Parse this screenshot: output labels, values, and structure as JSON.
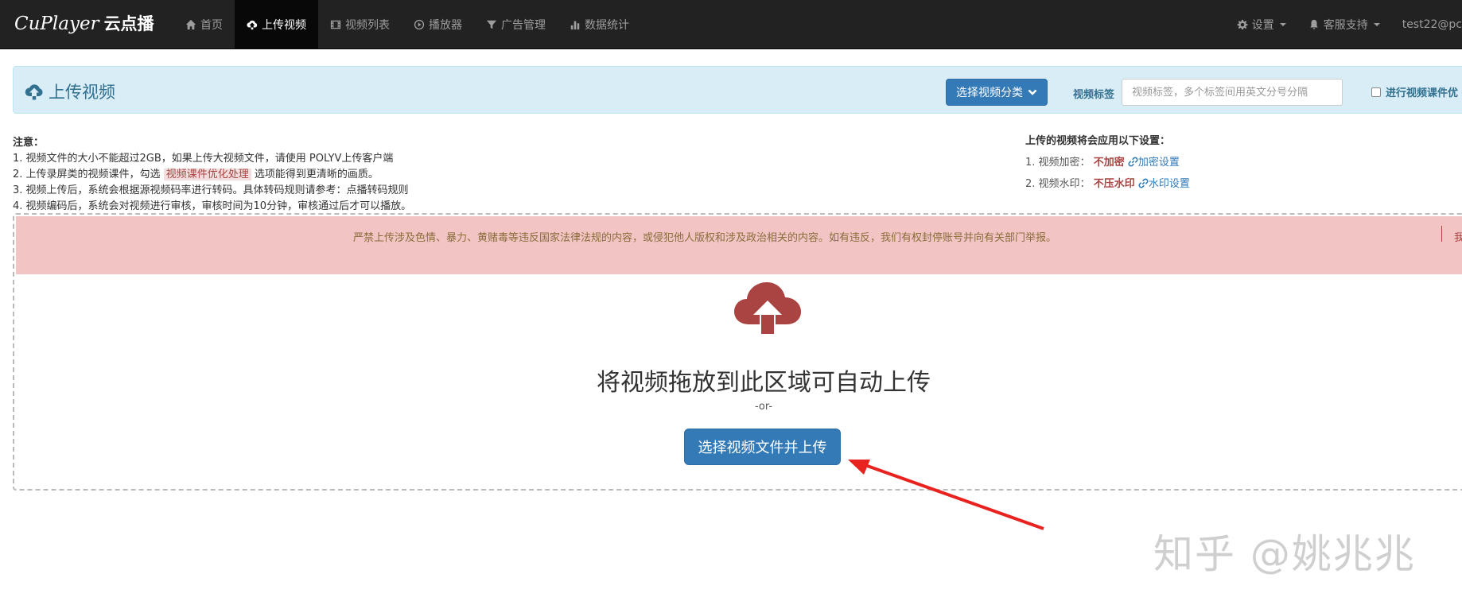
{
  "navbar": {
    "brand": "CuPlayer",
    "brand_cn": "云点播",
    "items": [
      {
        "label": "首页",
        "icon": "home-icon"
      },
      {
        "label": "上传视频",
        "icon": "cloud-upload-icon",
        "active": true
      },
      {
        "label": "视频列表",
        "icon": "film-icon"
      },
      {
        "label": "播放器",
        "icon": "play-circle-icon"
      },
      {
        "label": "广告管理",
        "icon": "filter-icon"
      },
      {
        "label": "数据统计",
        "icon": "bar-chart-icon"
      }
    ],
    "right": {
      "settings": "设置",
      "support": "客服支持",
      "user": "test22@pc"
    }
  },
  "upload_panel": {
    "title": "上传视频",
    "category_button": "选择视频分类",
    "tag_label": "视频标签",
    "tag_placeholder": "视频标签，多个标签间用英文分号分隔",
    "optimize_label": "进行视频课件优"
  },
  "notes": {
    "heading": "注意：",
    "line1": "1. 视频文件的大小不能超过2GB，如果上传大视频文件，请使用 POLYV上传客户端",
    "line2_pre": "2. 上传录屏类的视频课件，勾选",
    "line2_hl": "视频课件优化处理",
    "line2_post": "选项能得到更清晰的画质。",
    "line3": "3. 视频上传后，系统会根据源视频码率进行转码。具体转码规则请参考：点播转码规则",
    "line4": "4. 视频编码后，系统会对视频进行审核，审核时间为10分钟，审核通过后才可以播放。"
  },
  "settings": {
    "heading": "上传的视频将会应用以下设置：",
    "encrypt_label": "1. 视频加密：",
    "encrypt_value": "不加密",
    "encrypt_link": "加密设置",
    "watermark_label": "2. 视频水印：",
    "watermark_value": "不压水印",
    "watermark_link": "水印设置"
  },
  "dropzone": {
    "warning": "严禁上传涉及色情、暴力、黄赌毒等违反国家法律法规的内容，或侵犯他人版权和涉及政治相关的内容。如有违反，我们有权封停账号并向有关部门举报。",
    "warning_tail": "我",
    "title": "将视频拖放到此区域可自动上传",
    "or": "-or-",
    "select_button": "选择视频文件并上传",
    "cloud_color": "#a94442"
  },
  "watermark_text": "知乎 @姚兆兆"
}
